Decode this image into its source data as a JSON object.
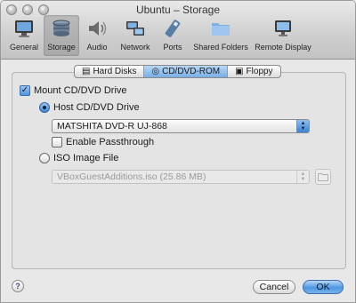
{
  "window": {
    "title": "Ubuntu – Storage"
  },
  "toolbar": {
    "items": [
      {
        "label": "General",
        "icon": "monitor-icon"
      },
      {
        "label": "Storage",
        "icon": "storage-icon",
        "active": true
      },
      {
        "label": "Audio",
        "icon": "speaker-icon"
      },
      {
        "label": "Network",
        "icon": "network-icon"
      },
      {
        "label": "Ports",
        "icon": "ports-icon"
      },
      {
        "label": "Shared Folders",
        "icon": "folder-icon"
      },
      {
        "label": "Remote Display",
        "icon": "remote-display-icon"
      }
    ]
  },
  "tabs": [
    {
      "label": "Hard Disks",
      "icon": "hard-disk-icon"
    },
    {
      "label": "CD/DVD-ROM",
      "icon": "cd-icon",
      "active": true
    },
    {
      "label": "Floppy",
      "icon": "floppy-icon"
    }
  ],
  "storage": {
    "mount_label": "Mount CD/DVD Drive",
    "host_drive_label": "Host CD/DVD Drive",
    "host_drive_value": "MATSHITA DVD-R   UJ-868",
    "passthrough_label": "Enable Passthrough",
    "iso_label": "ISO Image File",
    "iso_value": "VBoxGuestAdditions.iso (25.86 MB)"
  },
  "footer": {
    "help_label": "?",
    "cancel_label": "Cancel",
    "ok_label": "OK"
  },
  "colors": {
    "accent": "#4d97e3"
  }
}
